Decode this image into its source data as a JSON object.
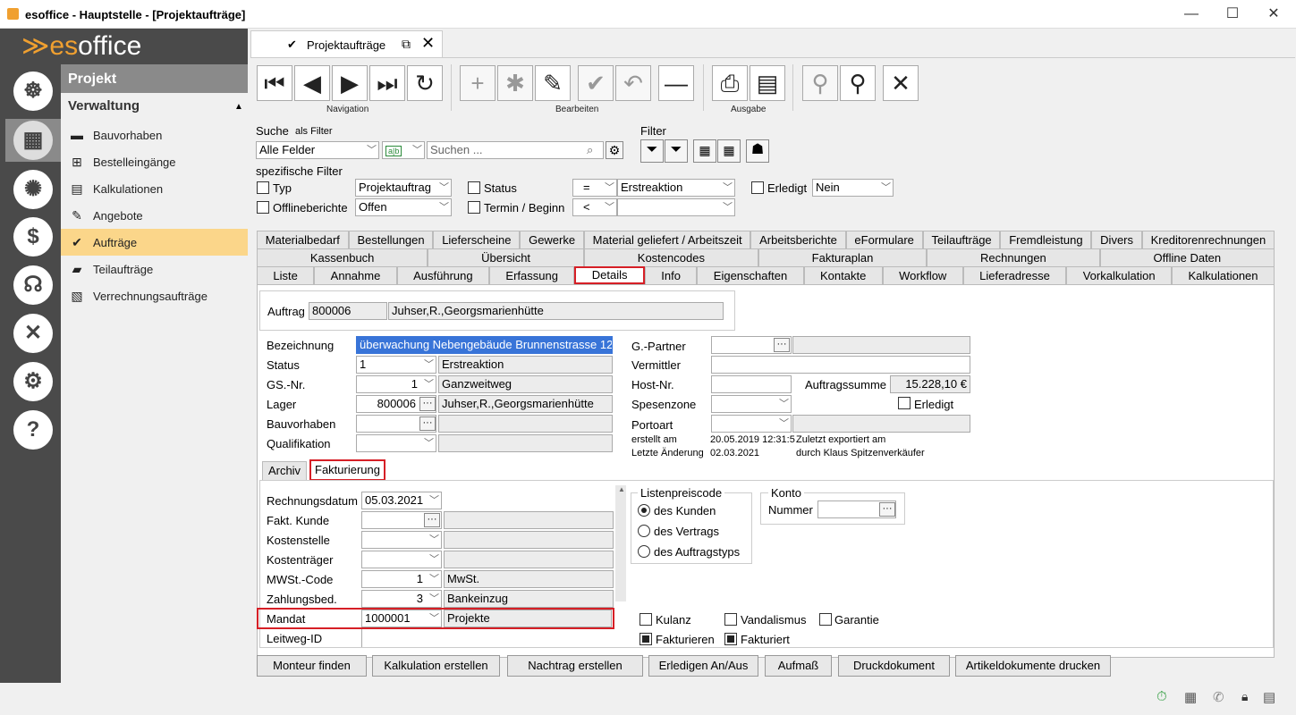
{
  "window": {
    "title": "esoffice - Hauptstelle - [Projektaufträge]",
    "min": "—",
    "max": "☐",
    "close": "✕"
  },
  "logo": {
    "prefix": "≫es",
    "suffix": "office"
  },
  "sidebar": {
    "header": "Projekt",
    "section": "Verwaltung",
    "items": [
      {
        "label": "Bauvorhaben",
        "icon": "bauvorhaben-icon"
      },
      {
        "label": "Bestelleingänge",
        "icon": "cart-icon"
      },
      {
        "label": "Kalkulationen",
        "icon": "calculation-icon"
      },
      {
        "label": "Angebote",
        "icon": "offer-icon"
      },
      {
        "label": "Aufträge",
        "icon": "check-circle-icon"
      },
      {
        "label": "Teilaufträge",
        "icon": "partial-order-icon"
      },
      {
        "label": "Verrechnungsaufträge",
        "icon": "settlement-icon"
      }
    ]
  },
  "doc_tab": {
    "label": "Projektaufträge"
  },
  "toolbar": {
    "navigation": "Navigation",
    "edit": "Bearbeiten",
    "output": "Ausgabe"
  },
  "search": {
    "label": "Suche",
    "as_filter": "als Filter",
    "field": "Alle Felder",
    "placeholder": "Suchen ...",
    "filter_label": "Filter",
    "specific": "spezifische Filter"
  },
  "filters": {
    "typ_label": "Typ",
    "typ_value": "Projektauftrag",
    "offline_label": "Offlineberichte",
    "offline_value": "Offen",
    "status_label": "Status",
    "status_op": "=",
    "status_value": "Erstreaktion",
    "termin_label": "Termin / Beginn",
    "termin_op": "<",
    "termin_value": "",
    "erledigt_label": "Erledigt",
    "erledigt_value": "Nein"
  },
  "tabs_row1": [
    "Materialbedarf",
    "Bestellungen",
    "Lieferscheine",
    "Gewerke",
    "Material geliefert / Arbeitszeit",
    "Arbeitsberichte",
    "eFormulare",
    "Teilaufträge",
    "Fremdleistung",
    "Divers",
    "Kreditorenrechnungen"
  ],
  "tabs_row2": [
    "Kassenbuch",
    "Übersicht",
    "Kostencodes",
    "Fakturaplan",
    "Rechnungen",
    "Offline Daten"
  ],
  "tabs_row3": [
    "Liste",
    "Annahme",
    "Ausführung",
    "Erfassung",
    "Details",
    "Info",
    "Eigenschaften",
    "Kontakte",
    "Workflow",
    "Lieferadresse",
    "Vorkalkulation",
    "Kalkulationen"
  ],
  "auftrag": {
    "label": "Auftrag",
    "nr": "800006",
    "name": "Juhser,R.,Georgsmarienhütte"
  },
  "details": {
    "bezeichnung_label": "Bezeichnung",
    "bezeichnung": "überwachung Nebengebäude Brunnenstrasse 12",
    "status_label": "Status",
    "status_code": "1",
    "status_text": "Erstreaktion",
    "gs_label": "GS.-Nr.",
    "gs_code": "1",
    "gs_text": "Ganzweitweg",
    "lager_label": "Lager",
    "lager_code": "800006",
    "lager_text": "Juhser,R.,Georgsmarienhütte",
    "bauvorhaben_label": "Bauvorhaben",
    "qualifikation_label": "Qualifikation",
    "gpartner_label": "G.-Partner",
    "vermittler_label": "Vermittler",
    "host_label": "Host-Nr.",
    "auftragssumme_label": "Auftragssumme",
    "auftragssumme": "15.228,10 €",
    "spesenzone_label": "Spesenzone",
    "erledigt_label": "Erledigt",
    "portoart_label": "Portoart",
    "erstellt_label": "erstellt am",
    "erstellt_value": "20.05.2019 12:31:5",
    "aenderung_label": "Letzte Änderung",
    "aenderung_value": "02.03.2021",
    "export_line1": "Zuletzt exportiert am",
    "export_line2": "durch Klaus Spitzenverkäufer"
  },
  "subtabs": [
    "Archiv",
    "Fakturierung"
  ],
  "faktura": {
    "rechnungsdatum_label": "Rechnungsdatum",
    "rechnungsdatum": "05.03.2021",
    "kunde_label": "Fakt. Kunde",
    "kostenstelle_label": "Kostenstelle",
    "kostentraeger_label": "Kostenträger",
    "mwst_label": "MWSt.-Code",
    "mwst_code": "1",
    "mwst_text": "MwSt.",
    "zahlung_label": "Zahlungsbed.",
    "zahlung_code": "3",
    "zahlung_text": "Bankeinzug",
    "mandat_label": "Mandat",
    "mandat_code": "1000001",
    "mandat_text": "Projekte",
    "leitweg_label": "Leitweg-ID"
  },
  "listenpreis": {
    "title": "Listenpreiscode",
    "opt1": "des Kunden",
    "opt2": "des Vertrags",
    "opt3": "des Auftragstyps"
  },
  "konto": {
    "title": "Konto",
    "nummer_label": "Nummer"
  },
  "checks": {
    "kulanz": "Kulanz",
    "vandalismus": "Vandalismus",
    "garantie": "Garantie",
    "fakturieren": "Fakturieren",
    "fakturiert": "Fakturiert"
  },
  "buttons": [
    "Monteur finden",
    "Kalkulation erstellen",
    "Nachtrag erstellen",
    "Erledigen An/Aus",
    "Aufmaß",
    "Druckdokument",
    "Artikeldokumente drucken"
  ]
}
